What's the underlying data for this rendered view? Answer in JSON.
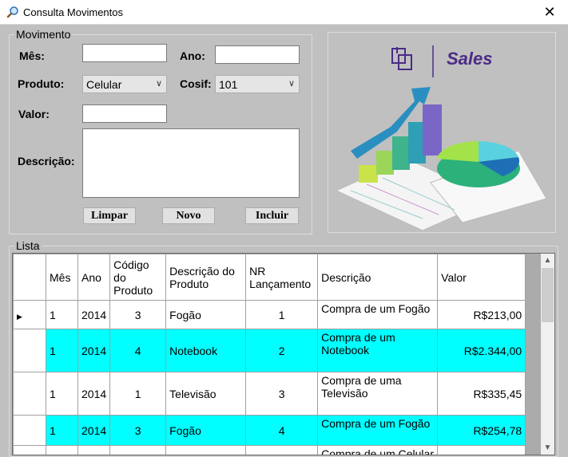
{
  "window": {
    "title": "Consulta Movimentos",
    "close_glyph": "✕"
  },
  "movimento": {
    "legend": "Movimento",
    "mes_label": "Mês:",
    "mes_value": "",
    "ano_label": "Ano:",
    "ano_value": "",
    "produto_label": "Produto:",
    "produto_value": "Celular",
    "cosif_label": "Cosif:",
    "cosif_value": "101",
    "valor_label": "Valor:",
    "valor_value": "",
    "descricao_label": "Descrição:",
    "descricao_value": "",
    "buttons": {
      "limpar": "Limpar",
      "novo": "Novo",
      "incluir": "Incluir"
    }
  },
  "image": {
    "text": "Sales",
    "accent": "#4b2a86"
  },
  "lista": {
    "legend": "Lista",
    "columns": [
      "Mês",
      "Ano",
      "Código do Produto",
      "Descrição do Produto",
      "NR Lançamento",
      "Descrição",
      "Valor"
    ],
    "rows": [
      {
        "mes": "1",
        "ano": "2014",
        "codigo": "3",
        "produto": "Fogão",
        "nr": "1",
        "descricao": "Compra de um Fogão",
        "valor": "R$213,00",
        "selected": false,
        "current": true
      },
      {
        "mes": "1",
        "ano": "2014",
        "codigo": "4",
        "produto": "Notebook",
        "nr": "2",
        "descricao": "Compra de um Notebook",
        "valor": "R$2.344,00",
        "selected": true,
        "current": false
      },
      {
        "mes": "1",
        "ano": "2014",
        "codigo": "1",
        "produto": "Televisão",
        "nr": "3",
        "descricao": "Compra de uma Televisão",
        "valor": "R$335,45",
        "selected": false,
        "current": false
      },
      {
        "mes": "1",
        "ano": "2014",
        "codigo": "3",
        "produto": "Fogão",
        "nr": "4",
        "descricao": "Compra de um Fogão",
        "valor": "R$254,78",
        "selected": true,
        "current": false
      },
      {
        "mes": "",
        "ano": "",
        "codigo": "",
        "produto": "",
        "nr": "",
        "descricao": "Compra de um Celular",
        "valor": "",
        "selected": false,
        "current": false
      }
    ],
    "selection_color": "#00ffff"
  }
}
